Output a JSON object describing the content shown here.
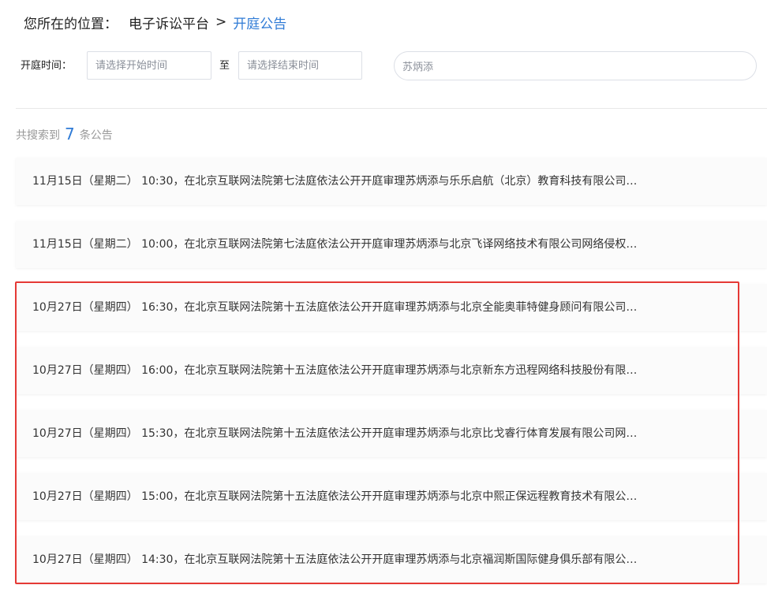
{
  "breadcrumb": {
    "label": "您所在的位置：",
    "root": "电子诉讼平台",
    "separator": ">",
    "current": "开庭公告"
  },
  "filters": {
    "date_label": "开庭时间：",
    "start_placeholder": "请选择开始时间",
    "range_separator": "至",
    "end_placeholder": "请选择结束时间",
    "keyword_value": "苏炳添"
  },
  "results": {
    "prefix": "共搜索到",
    "count": "7",
    "suffix": "条公告"
  },
  "notices": [
    {
      "text": "11月15日（星期二） 10:30，在北京互联网法院第七法庭依法公开开庭审理苏炳添与乐乐启航（北京）教育科技有限公司…"
    },
    {
      "text": "11月15日（星期二） 10:00，在北京互联网法院第七法庭依法公开开庭审理苏炳添与北京飞译网络技术有限公司网络侵权…"
    },
    {
      "text": "10月27日（星期四） 16:30，在北京互联网法院第十五法庭依法公开开庭审理苏炳添与北京全能奥菲特健身顾问有限公司…"
    },
    {
      "text": "10月27日（星期四） 16:00，在北京互联网法院第十五法庭依法公开开庭审理苏炳添与北京新东方迅程网络科技股份有限…"
    },
    {
      "text": "10月27日（星期四） 15:30，在北京互联网法院第十五法庭依法公开开庭审理苏炳添与北京比戈睿行体育发展有限公司网…"
    },
    {
      "text": "10月27日（星期四） 15:00，在北京互联网法院第十五法庭依法公开开庭审理苏炳添与北京中熙正保远程教育技术有限公…"
    },
    {
      "text": "10月27日（星期四） 14:30，在北京互联网法院第十五法庭依法公开开庭审理苏炳添与北京福润斯国际健身俱乐部有限公…"
    }
  ],
  "colors": {
    "accent": "#2f7bd6",
    "highlight_border": "#e53935"
  }
}
